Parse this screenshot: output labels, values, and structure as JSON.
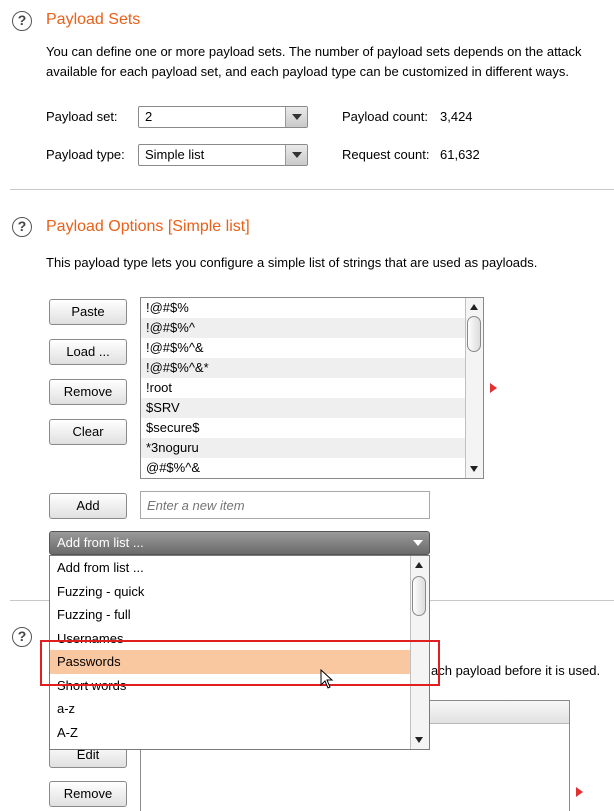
{
  "payload_sets": {
    "title": "Payload Sets",
    "desc_line1": "You can define one or more payload sets. The number of payload sets depends on the attack",
    "desc_line2": "available for each payload set, and each payload type can be customized in different ways.",
    "payload_set_label": "Payload set:",
    "payload_set_value": "2",
    "payload_type_label": "Payload type:",
    "payload_type_value": "Simple list",
    "payload_count_label": "Payload count:",
    "payload_count_value": "3,424",
    "request_count_label": "Request count:",
    "request_count_value": "61,632"
  },
  "payload_options": {
    "title": "Payload Options [Simple list]",
    "desc": "This payload type lets you configure a simple list of strings that are used as payloads.",
    "buttons": {
      "paste": "Paste",
      "load": "Load ...",
      "remove": "Remove",
      "clear": "Clear",
      "add": "Add"
    },
    "items": [
      "!@#$%",
      "!@#$%^",
      "!@#$%^&",
      "!@#$%^&*",
      "!root",
      "$SRV",
      "$secure$",
      "*3noguru",
      "@#$%^&"
    ],
    "new_item_placeholder": "Enter a new item",
    "add_from_list_selected": "Add from list ...",
    "add_from_list_options": [
      "Add from list ...",
      "Fuzzing - quick",
      "Fuzzing - full",
      "Usernames",
      "Passwords",
      "Short words",
      "a-z",
      "A-Z"
    ],
    "highlighted_option": "Passwords"
  },
  "payload_processing": {
    "desc_fragment": "ach payload before it is used.",
    "buttons": {
      "edit": "Edit",
      "remove": "Remove"
    }
  },
  "colors": {
    "title_accent": "#e8601a",
    "selection": "#f9c8a0",
    "callout": "#e02020"
  }
}
